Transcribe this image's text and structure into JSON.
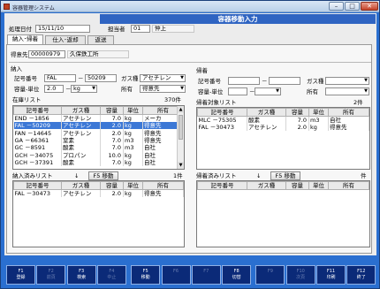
{
  "window": {
    "title": "容器管理システム"
  },
  "banner": "容器移動入力",
  "header": {
    "date_label": "処理日付",
    "date_value": "15/11/10",
    "staff_label": "担当者",
    "staff_code": "01",
    "staff_name": "仲上"
  },
  "tabs": [
    {
      "label": "納入･帰着"
    },
    {
      "label": "仕入･返却"
    },
    {
      "label": "返送"
    }
  ],
  "customer": {
    "label": "得意先",
    "code": "00000979",
    "name": "久保鉄工所"
  },
  "delivery": {
    "section_label": "納入",
    "serial_label": "記号番号",
    "serial_prefix": "FAL",
    "serial_sep": "－",
    "serial_number": "50209",
    "gas_label": "ガス種",
    "gas_value": "アセチレン",
    "cap_label": "容量-単位",
    "cap_value": "2.0",
    "cap_sep": "－",
    "unit_value": "kg",
    "owner_label": "所有",
    "owner_value": "得意先"
  },
  "stock_list": {
    "label": "在庫リスト",
    "count": "370件",
    "columns": [
      "記号番号",
      "ガス種",
      "容量",
      "単位",
      "所有"
    ],
    "rows": [
      [
        "END －1856",
        "アセチレン",
        "7.0",
        "kg",
        "メーカ"
      ],
      [
        "FAL －50209",
        "アセチレン",
        "2.0",
        "kg",
        "得意先"
      ],
      [
        "FAN －14645",
        "アセチレン",
        "2.0",
        "kg",
        "得意先"
      ],
      [
        "GA －66361",
        "窒素",
        "7.0",
        "m3",
        "得意先"
      ],
      [
        "GC －8591",
        "酸素",
        "7.0",
        "m3",
        "自社"
      ],
      [
        "GCH －34075",
        "プロパン",
        "10.0",
        "kg",
        "自社"
      ],
      [
        "GCH －37391",
        "酸素",
        "7.0",
        "kg",
        "自社"
      ]
    ]
  },
  "delivered_list": {
    "label": "納入済みリスト",
    "arrow": "↓",
    "move_label": "F5 移動",
    "count": "1件",
    "columns": [
      "記号番号",
      "ガス種",
      "容量",
      "単位",
      "所有"
    ],
    "rows": [
      [
        "FAL －30473",
        "アセチレン",
        "2.0",
        "kg",
        "得意先"
      ]
    ]
  },
  "return": {
    "section_label": "帰着",
    "serial_label": "記号番号",
    "serial_sep": "－",
    "gas_label": "ガス種",
    "cap_label": "容量-単位",
    "cap_sep": "－",
    "owner_label": "所有"
  },
  "return_target_list": {
    "label": "帰着対象リスト",
    "count": "2件",
    "columns": [
      "記号番号",
      "ガス種",
      "容量",
      "単位",
      "所有"
    ],
    "rows": [
      [
        "MLC －75305",
        "酸素",
        "7.0",
        "m3",
        "自社"
      ],
      [
        "FAL －30473",
        "アセチレン",
        "2.0",
        "kg",
        "得意先"
      ]
    ]
  },
  "returned_list": {
    "label": "帰着済みリスト",
    "arrow": "↓",
    "move_label": "F5 移動",
    "count": "件",
    "columns": [
      "記号番号",
      "ガス種",
      "容量",
      "単位",
      "所有"
    ],
    "rows": []
  },
  "fkeys": [
    {
      "key": "F1",
      "label": "登録",
      "enabled": true
    },
    {
      "key": "F2",
      "label": "前頁",
      "enabled": false
    },
    {
      "key": "F3",
      "label": "検索",
      "enabled": true
    },
    {
      "key": "F4",
      "label": "中止",
      "enabled": false
    },
    {
      "key": "F5",
      "label": "移動",
      "enabled": true
    },
    {
      "key": "F6",
      "label": "",
      "enabled": false
    },
    {
      "key": "F7",
      "label": "",
      "enabled": false
    },
    {
      "key": "F8",
      "label": "切替",
      "enabled": true
    },
    {
      "key": "F9",
      "label": "",
      "enabled": false
    },
    {
      "key": "F10",
      "label": "次頁",
      "enabled": false
    },
    {
      "key": "F11",
      "label": "印刷",
      "enabled": true
    },
    {
      "key": "F12",
      "label": "終了",
      "enabled": true
    }
  ]
}
